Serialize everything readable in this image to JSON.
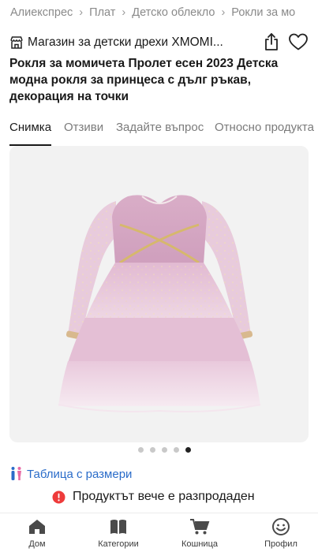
{
  "breadcrumb": {
    "items": [
      "Алиекспрес",
      "Плат",
      "Детско облекло",
      "Рокли за мо"
    ]
  },
  "store": {
    "name": "Магазин за детски дрехи XMOMI..."
  },
  "product": {
    "title": "Рокля за момичета Пролет есен 2023 Детска модна рокля за принцеса с дълг ръкав, декорация на точки"
  },
  "tabs": [
    {
      "label": "Снимка",
      "active": true
    },
    {
      "label": "Отзиви",
      "active": false
    },
    {
      "label": "Задайте въпрос",
      "active": false
    },
    {
      "label": "Относно продукта",
      "active": false
    }
  ],
  "gallery": {
    "image_count": 5,
    "active_index": 4
  },
  "size_chart": {
    "label": "Таблица с размери"
  },
  "status": {
    "message": "Продуктът вече е разпродаден",
    "color": "#ee3b3b"
  },
  "bottom_nav": {
    "items": [
      {
        "label": "Дом"
      },
      {
        "label": "Категории"
      },
      {
        "label": "Кошница"
      },
      {
        "label": "Профил"
      }
    ]
  },
  "colors": {
    "link": "#2a6cc9",
    "active_dot": "#222222",
    "dress": "#dcb3cc"
  }
}
